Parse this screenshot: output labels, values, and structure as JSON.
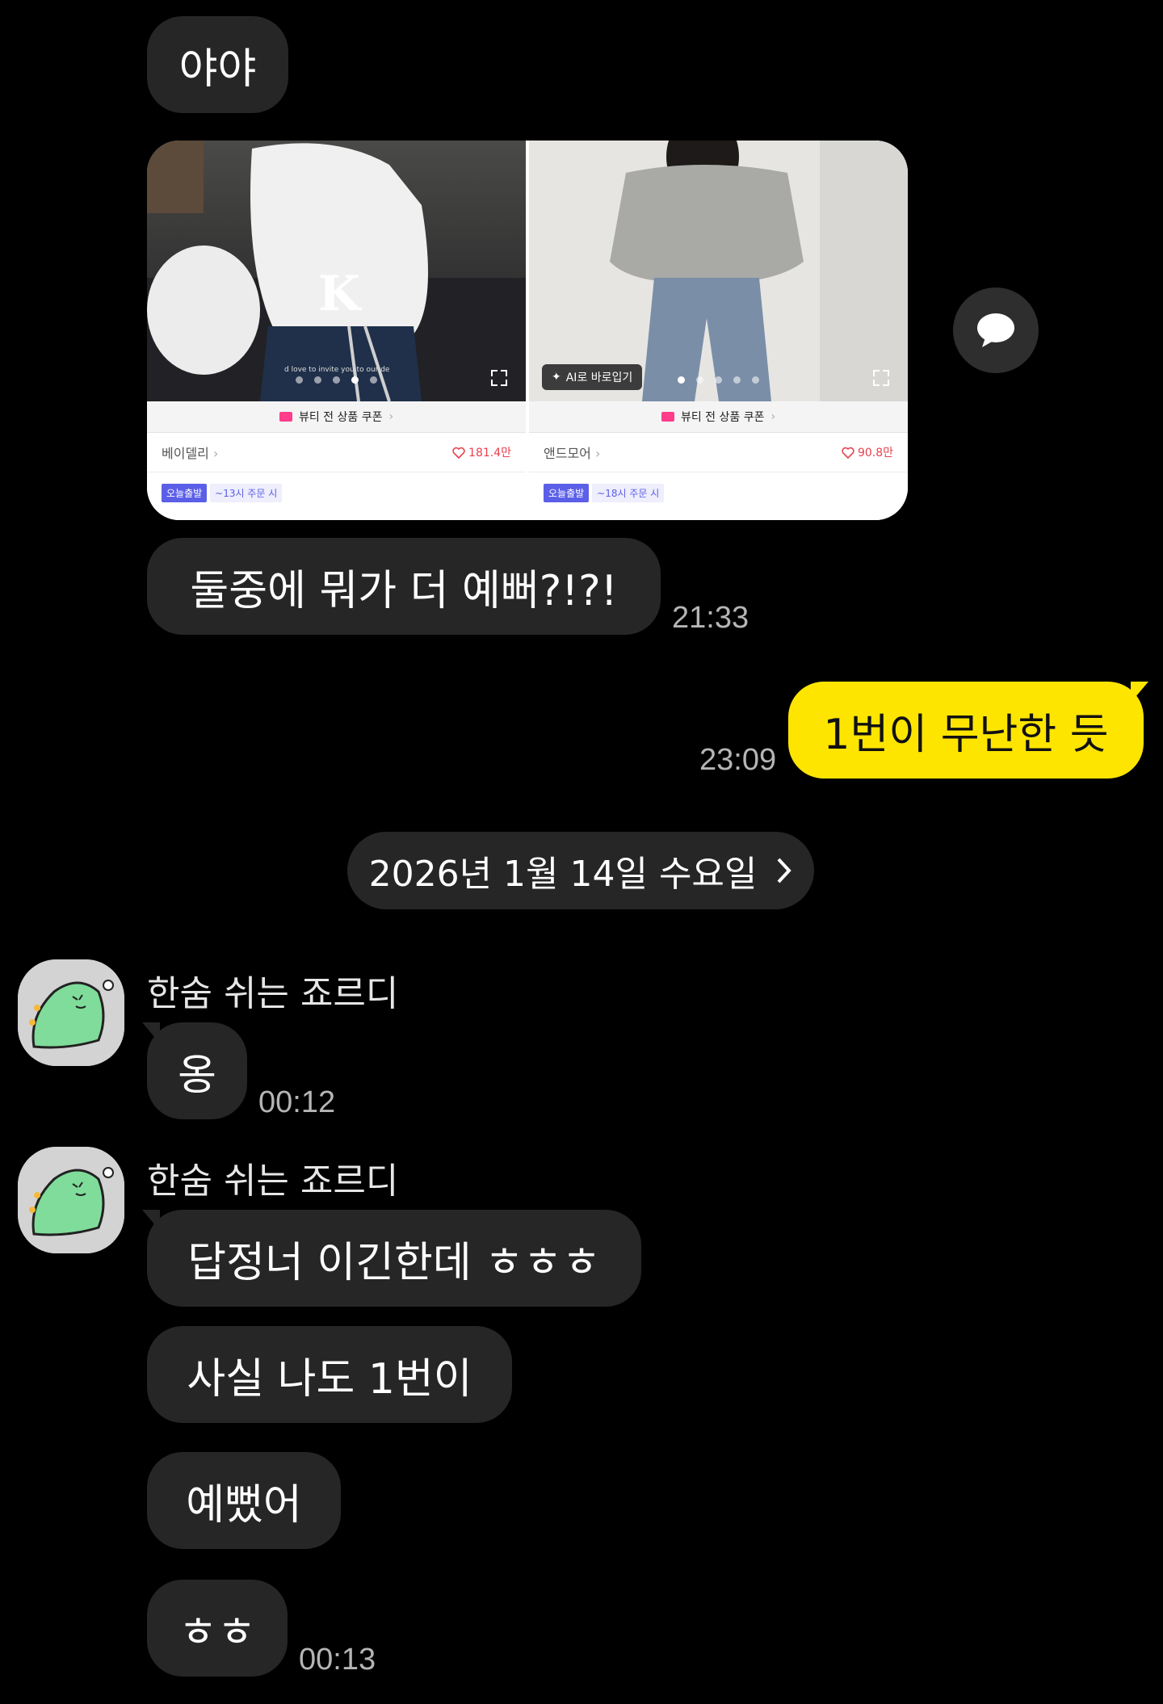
{
  "messages": {
    "m1": "야야",
    "m2": "둘중에 뭐가 더 예뻐?!?!",
    "m2_time": "21:33",
    "m3_me": "1번이 무난한 듯",
    "m3_time": "23:09",
    "date_divider": "2026년 1월 14일 수요일",
    "sender_name": "한숨 쉬는 죠르디",
    "m4": "옹",
    "m4_time": "00:12",
    "m5": "답정너 이긴한데 ㅎㅎㅎ",
    "m6": "사실 나도 1번이",
    "m7": "예뻤어",
    "m8": "ㅎㅎ",
    "m8_time": "00:13"
  },
  "products": [
    {
      "coupon": "뷰티 전 상품 쿠폰",
      "brand": "베이델리",
      "likes": "181.4만",
      "ship_badge": "오늘출발",
      "ship_note": "~13시 주문 시",
      "overlay_text": "d love to invite you to our de"
    },
    {
      "coupon": "뷰티 전 상품 쿠폰",
      "brand": "앤드모어",
      "likes": "90.8만",
      "ship_badge": "오늘출발",
      "ship_note": "~18시 주문 시",
      "ai_button": "AI로 바로입기"
    }
  ],
  "colors": {
    "my_bubble": "#FEE500",
    "their_bubble": "#262626",
    "background": "#000000"
  }
}
